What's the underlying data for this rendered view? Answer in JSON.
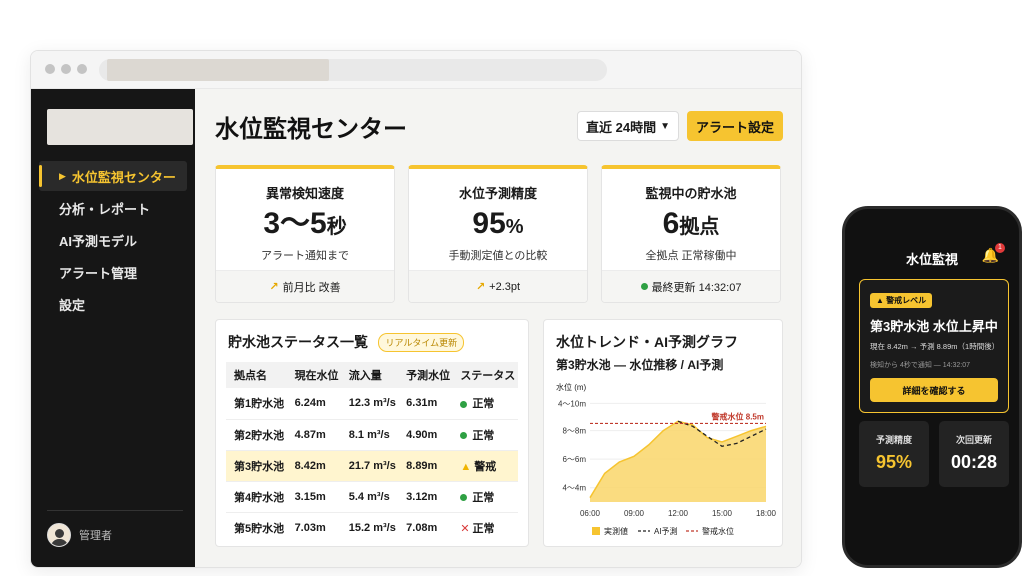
{
  "app": {
    "page_title": "水位監視センター",
    "range_select": "直近 24時間",
    "alert_button": "アラート設定"
  },
  "sidebar": {
    "items": [
      {
        "label": "水位監視センター",
        "active": true
      },
      {
        "label": "分析・レポート",
        "active": false
      },
      {
        "label": "AI予測モデル",
        "active": false
      },
      {
        "label": "アラート管理",
        "active": false
      },
      {
        "label": "設定",
        "active": false
      }
    ],
    "user_name": "管理者"
  },
  "kpis": [
    {
      "label": "異常検知速度",
      "value": "3〜5",
      "unit": "秒",
      "sub": "アラート通知まで",
      "foot": "前月比 改善"
    },
    {
      "label": "水位予測精度",
      "value": "95",
      "unit": "%",
      "sub": "手動測定値との比較",
      "foot": "+2.3pt"
    },
    {
      "label": "監視中の貯水池",
      "value": "6",
      "unit": "拠点",
      "sub": "全拠点 正常稼働中",
      "foot": "最終更新 14:32:07"
    }
  ],
  "table": {
    "title": "貯水池ステータス一覧",
    "badge": "リアルタイム更新",
    "headers": [
      "拠点名",
      "現在水位",
      "流入量",
      "予測水位",
      "ステータス"
    ],
    "rows": [
      {
        "name": "第1貯水池",
        "level": "6.24m",
        "inflow": "12.3 m³/s",
        "forecast": "6.31m",
        "status": "正常",
        "kind": "ok"
      },
      {
        "name": "第2貯水池",
        "level": "4.87m",
        "inflow": "8.1 m³/s",
        "forecast": "4.90m",
        "status": "正常",
        "kind": "ok"
      },
      {
        "name": "第3貯水池",
        "level": "8.42m",
        "inflow": "21.7 m³/s",
        "forecast": "8.89m",
        "status": "警戒",
        "kind": "warn"
      },
      {
        "name": "第4貯水池",
        "level": "3.15m",
        "inflow": "5.4 m³/s",
        "forecast": "3.12m",
        "status": "正常",
        "kind": "ok"
      },
      {
        "name": "第5貯水池",
        "level": "7.03m",
        "inflow": "15.2 m³/s",
        "forecast": "7.08m",
        "status": "正常",
        "kind": "x"
      }
    ]
  },
  "chart_panel": {
    "title": "水位トレンド・AI予測グラフ",
    "subtitle": "第3貯水池 — 水位推移 / AI予測"
  },
  "chart_data": {
    "type": "area",
    "ylabel": "水位 (m)",
    "y_ticks": [
      "4〜10m",
      "8〜8m",
      "6〜6m",
      "4〜4m"
    ],
    "x_ticks": [
      "06:00",
      "09:00",
      "12:00",
      "15:00",
      "18:00"
    ],
    "x_hours": [
      6,
      7,
      8,
      9,
      10,
      11,
      12,
      13,
      14,
      15,
      16,
      17,
      18
    ],
    "series": [
      {
        "name": "実測値",
        "style": "area",
        "color": "#f6c430",
        "values": [
          3.3,
          5.0,
          5.8,
          6.2,
          7.0,
          8.0,
          8.65,
          8.4,
          7.5,
          7.2,
          7.6,
          8.0,
          8.3
        ]
      },
      {
        "name": "AI予測",
        "style": "dashed",
        "color": "#222222",
        "hours": [
          12,
          13,
          14,
          15,
          16,
          17,
          18
        ],
        "values": [
          8.65,
          8.3,
          7.6,
          6.9,
          7.1,
          7.6,
          8.1
        ]
      },
      {
        "name": "警戒水位",
        "style": "threshold",
        "color": "#c0392b",
        "values": [
          8.5
        ]
      }
    ],
    "threshold_label": "警戒水位 8.5m",
    "ylim": [
      3,
      10
    ]
  },
  "phone": {
    "title": "水位監視",
    "notif_count": "1",
    "alert_tag": "警戒レベル",
    "alert_title": "第3貯水池 水位上昇中",
    "alert_sub": "現在 8.42m → 予測 8.89m（1時間後）",
    "alert_note": "検知から 4秒で通知 — 14:32:07",
    "alert_button": "詳細を確認する",
    "card1_label": "予測精度",
    "card1_value": "95%",
    "card2_label": "次回更新",
    "card2_value": "00:28"
  },
  "colors": {
    "accent": "#f6c430",
    "sidebar_bg": "#161616",
    "ok": "#2ea043",
    "danger": "#d93a3a"
  }
}
